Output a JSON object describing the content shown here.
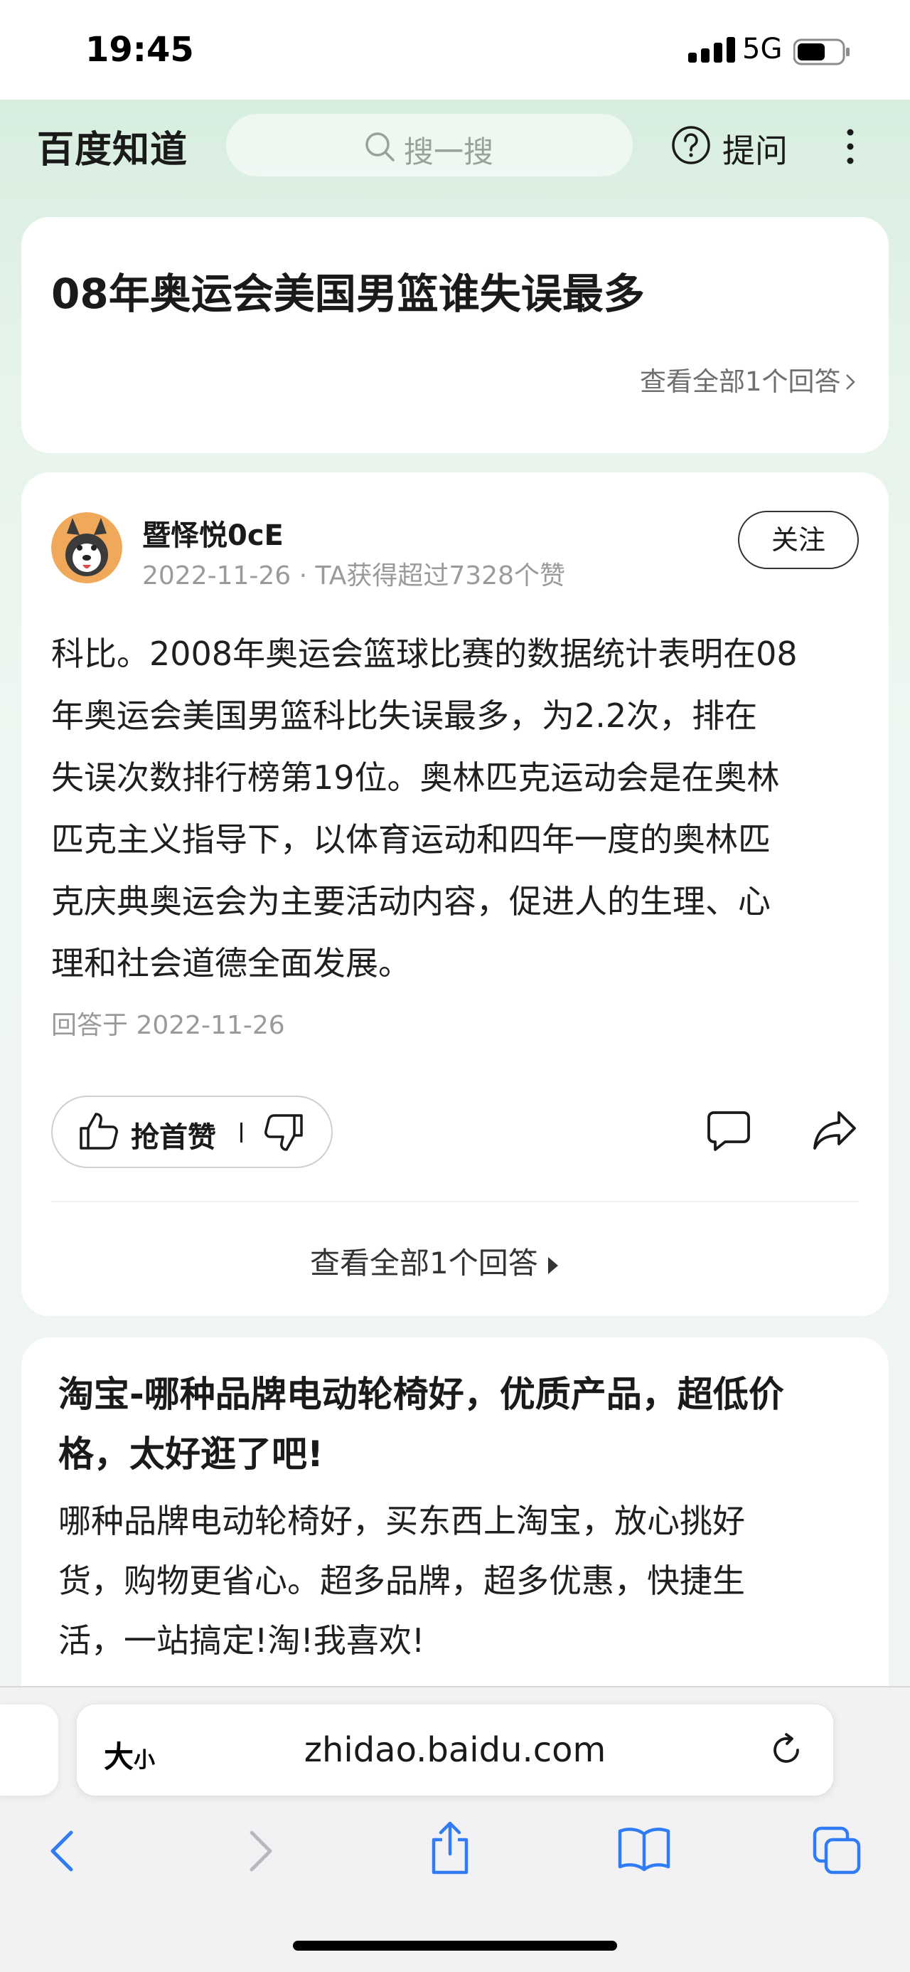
{
  "status_bar": {
    "time": "19:45",
    "network": "5G"
  },
  "header": {
    "logo": "百度知道",
    "search_placeholder": "搜一搜",
    "ask_label": "提问"
  },
  "question": {
    "title": "08年奥运会美国男篮谁失误最多",
    "view_all_label": "查看全部1个回答"
  },
  "answer": {
    "username": "暨怿悦0cE",
    "meta": "2022-11-26 · TA获得超过7328个赞",
    "follow_label": "关注",
    "lines": [
      "科比。2008年奥运会篮球比赛的数据统计表明在08",
      "年奥运会美国男篮科比失误最多，为2.2次，排在",
      "失误次数排行榜第19位。奥林匹克运动会是在奥林",
      "匹克主义指导下，以体育运动和四年一度的奥林匹",
      "克庆典奥运会为主要活动内容，促进人的生理、心",
      "理和社会道德全面发展。"
    ],
    "answered_on": "回答于 2022-11-26",
    "like_label": "抢首赞",
    "view_all_label": "查看全部1个回答"
  },
  "ad": {
    "title_lines": [
      "淘宝-哪种品牌电动轮椅好，优质产品，超低价",
      "格，太好逛了吧!"
    ],
    "body_lines": [
      "哪种品牌电动轮椅好，买东西上淘宝，放心挑好",
      "货，购物更省心。超多品牌，超多优惠，快捷生",
      "活，一站搞定!淘!我喜欢!"
    ]
  },
  "browser": {
    "text_size_big": "大",
    "text_size_small": "小",
    "url": "zhidao.baidu.com"
  },
  "colors": {
    "header_bg": "#d7eedf",
    "card_bg": "#ffffff",
    "meta_text": "#9a9a9a",
    "safari_accent": "#2f7cf6"
  }
}
